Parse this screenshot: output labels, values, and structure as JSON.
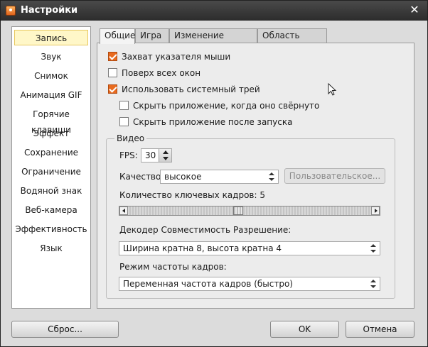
{
  "window": {
    "title": "Настройки",
    "close_glyph": "✕"
  },
  "sidebar": {
    "items": [
      {
        "label": "Запись",
        "active": true
      },
      {
        "label": "Звук"
      },
      {
        "label": "Снимок"
      },
      {
        "label": "Анимация GIF"
      },
      {
        "label": "Горячие клавиши"
      },
      {
        "label": "Эффект"
      },
      {
        "label": "Сохранение"
      },
      {
        "label": "Ограничение"
      },
      {
        "label": "Водяной знак"
      },
      {
        "label": "Веб-камера"
      },
      {
        "label": "Эффективность"
      },
      {
        "label": "Язык"
      }
    ]
  },
  "tabs": [
    {
      "label": "Общие",
      "active": true
    },
    {
      "label": "Игра"
    },
    {
      "label": "Изменение размера"
    },
    {
      "label": "Область записи"
    }
  ],
  "general": {
    "options": [
      {
        "label": "Захват указателя мыши",
        "checked": true
      },
      {
        "label": "Поверх всех окон",
        "checked": false
      },
      {
        "label": "Использовать системный трей",
        "checked": true
      },
      {
        "label": "Скрыть приложение, когда оно свёрнуто",
        "checked": false
      },
      {
        "label": "Скрыть приложение после запуска",
        "checked": false
      }
    ]
  },
  "video": {
    "group_title": "Видео",
    "fps_label": "FPS:",
    "fps_value": "30",
    "quality_label": "Качество:",
    "quality_value": "высокое",
    "custom_button": "Пользовательское...",
    "keyframes_label": "Количество ключевых кадров: 5",
    "keyframes_slider_fraction": 0.45,
    "decoder_label": "Декодер Совместимость Разрешение:",
    "decoder_value": "Ширина кратна 8, высота кратна 4",
    "framerate_label": "Режим частоты кадров:",
    "framerate_value": "Переменная частота кадров (быстро)"
  },
  "footer": {
    "reset": "Сброс...",
    "ok": "OK",
    "cancel": "Отмена"
  },
  "colors": {
    "accent_checkbox": "#e86a1e",
    "selection_bg": "#fff7c8"
  }
}
